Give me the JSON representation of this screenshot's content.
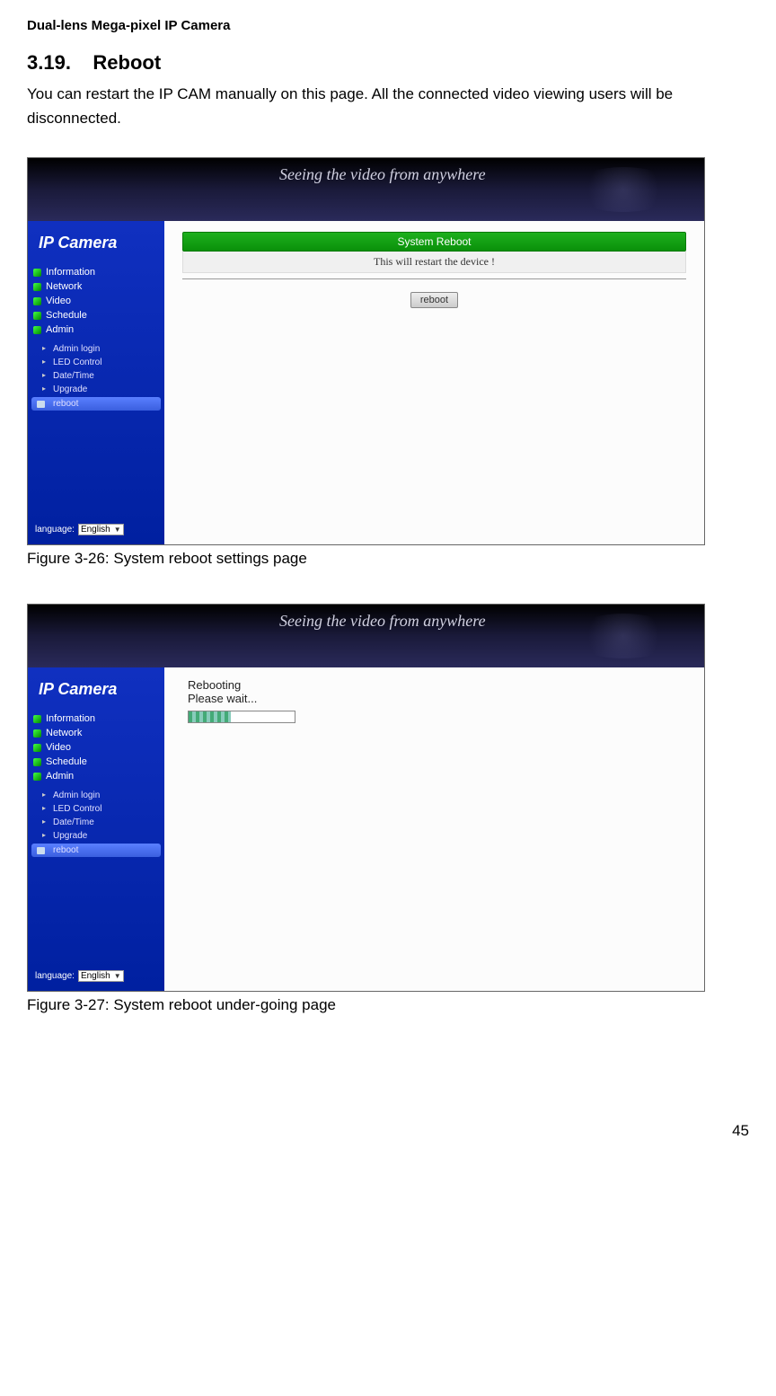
{
  "header": "Dual-lens Mega-pixel IP Camera",
  "section": {
    "number": "3.19.",
    "title": "Reboot",
    "body": "You can restart the IP CAM manually on this page. All the connected video viewing users will be disconnected."
  },
  "banner": {
    "tagline": "Seeing the video from anywhere"
  },
  "sidebar": {
    "logo": "IP Camera",
    "top": [
      "Information",
      "Network",
      "Video",
      "Schedule",
      "Admin"
    ],
    "sub": [
      "Admin login",
      "LED Control",
      "Date/Time",
      "Upgrade",
      "reboot"
    ],
    "language_label": "language:",
    "language_value": "English"
  },
  "figure1": {
    "system_title": "System Reboot",
    "restart_msg": "This will restart the device !",
    "button": "reboot",
    "caption": "Figure 3-26: System reboot settings page"
  },
  "figure2": {
    "line1": "Rebooting",
    "line2": "Please wait...",
    "caption": "Figure 3-27: System reboot under-going page"
  },
  "page_number": "45"
}
